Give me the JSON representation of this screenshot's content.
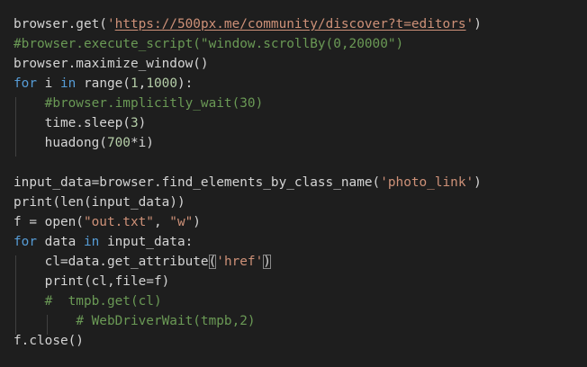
{
  "editor": {
    "theme_colors": {
      "background": "#1e1e1e",
      "text": "#d4d4d4",
      "string": "#ce9178",
      "keyword": "#569cd6",
      "number": "#b5cea8",
      "comment": "#6a9955",
      "indent_guide": "#404040"
    },
    "lines": [
      [
        {
          "t": "browser.get(",
          "c": "plain"
        },
        {
          "t": "'",
          "c": "string"
        },
        {
          "t": "https://500px.me/community/discover?t=editors",
          "c": "string",
          "link": true
        },
        {
          "t": "'",
          "c": "string"
        },
        {
          "t": ")",
          "c": "plain"
        }
      ],
      [
        {
          "t": "#browser.execute_script(\"window.scrollBy(0,20000\")",
          "c": "comment"
        }
      ],
      [
        {
          "t": "browser.maximize_window()",
          "c": "plain"
        }
      ],
      [
        {
          "t": "for",
          "c": "keyword"
        },
        {
          "t": " i ",
          "c": "plain"
        },
        {
          "t": "in",
          "c": "keyword"
        },
        {
          "t": " range(",
          "c": "plain"
        },
        {
          "t": "1",
          "c": "number"
        },
        {
          "t": ",",
          "c": "plain"
        },
        {
          "t": "1000",
          "c": "number"
        },
        {
          "t": "):",
          "c": "plain"
        }
      ],
      [
        {
          "t": "    ",
          "c": "plain"
        },
        {
          "t": "#browser.implicitly_wait(30)",
          "c": "comment"
        }
      ],
      [
        {
          "t": "    time.sleep(",
          "c": "plain"
        },
        {
          "t": "3",
          "c": "number"
        },
        {
          "t": ")",
          "c": "plain"
        }
      ],
      [
        {
          "t": "    huadong(",
          "c": "plain"
        },
        {
          "t": "700",
          "c": "number"
        },
        {
          "t": "*i)",
          "c": "plain"
        }
      ],
      [],
      [
        {
          "t": "input_data=browser.find_elements_by_class_name(",
          "c": "plain"
        },
        {
          "t": "'photo_link'",
          "c": "string"
        },
        {
          "t": ")",
          "c": "plain"
        }
      ],
      [
        {
          "t": "print(len(input_data))",
          "c": "plain"
        }
      ],
      [
        {
          "t": "f = open(",
          "c": "plain"
        },
        {
          "t": "\"out.txt\"",
          "c": "string"
        },
        {
          "t": ", ",
          "c": "plain"
        },
        {
          "t": "\"w\"",
          "c": "string"
        },
        {
          "t": ")",
          "c": "plain"
        }
      ],
      [
        {
          "t": "for",
          "c": "keyword"
        },
        {
          "t": " data ",
          "c": "plain"
        },
        {
          "t": "in",
          "c": "keyword"
        },
        {
          "t": " input_data:",
          "c": "plain"
        }
      ],
      [
        {
          "t": "    cl=data.get_attribute",
          "c": "plain"
        },
        {
          "t": "(",
          "c": "plain",
          "match": true
        },
        {
          "t": "'href'",
          "c": "string"
        },
        {
          "t": ")",
          "c": "plain",
          "match": true
        }
      ],
      [
        {
          "t": "    print(cl,file=f)",
          "c": "plain"
        }
      ],
      [
        {
          "t": "    ",
          "c": "plain"
        },
        {
          "t": "#  tmpb.get(cl)",
          "c": "comment"
        }
      ],
      [
        {
          "t": "        ",
          "c": "plain"
        },
        {
          "t": "# WebDriverWait(tmpb,2)",
          "c": "comment"
        }
      ],
      [
        {
          "t": "f.close()",
          "c": "plain"
        }
      ]
    ]
  }
}
